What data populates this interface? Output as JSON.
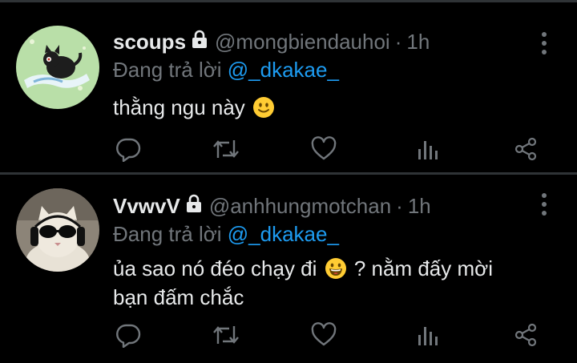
{
  "tweets": [
    {
      "name": "scoups",
      "handle": "@mongbiendauhoi",
      "separator": "·",
      "time": "1h",
      "replying_prefix": "Đang trả lời ",
      "replying_to": "@_dkakae_",
      "text_before": "thằng ngu này ",
      "text_after": "",
      "emoji": "slightly-smiling-face",
      "avatar_bg": "#b9dfa8"
    },
    {
      "name": "VvwvV",
      "handle": "@anhhungmotchan",
      "separator": "·",
      "time": "1h",
      "replying_prefix": "Đang trả lời ",
      "replying_to": "@_dkakae_",
      "text_before": "ủa sao nó đéo chạy đi ",
      "text_after": " ? nằm đấy mời bạn đấm chắc",
      "emoji": "grinning-squinting-face",
      "avatar_bg": "#8c8478"
    }
  ],
  "colors": {
    "background": "#000000",
    "text": "#e7e9ea",
    "secondary": "#71767b",
    "accent": "#1d9bf0",
    "divider": "#2f3336"
  },
  "icons": [
    "reply-icon",
    "retweet-icon",
    "like-icon",
    "views-icon",
    "share-icon",
    "more-icon",
    "lock-icon"
  ]
}
